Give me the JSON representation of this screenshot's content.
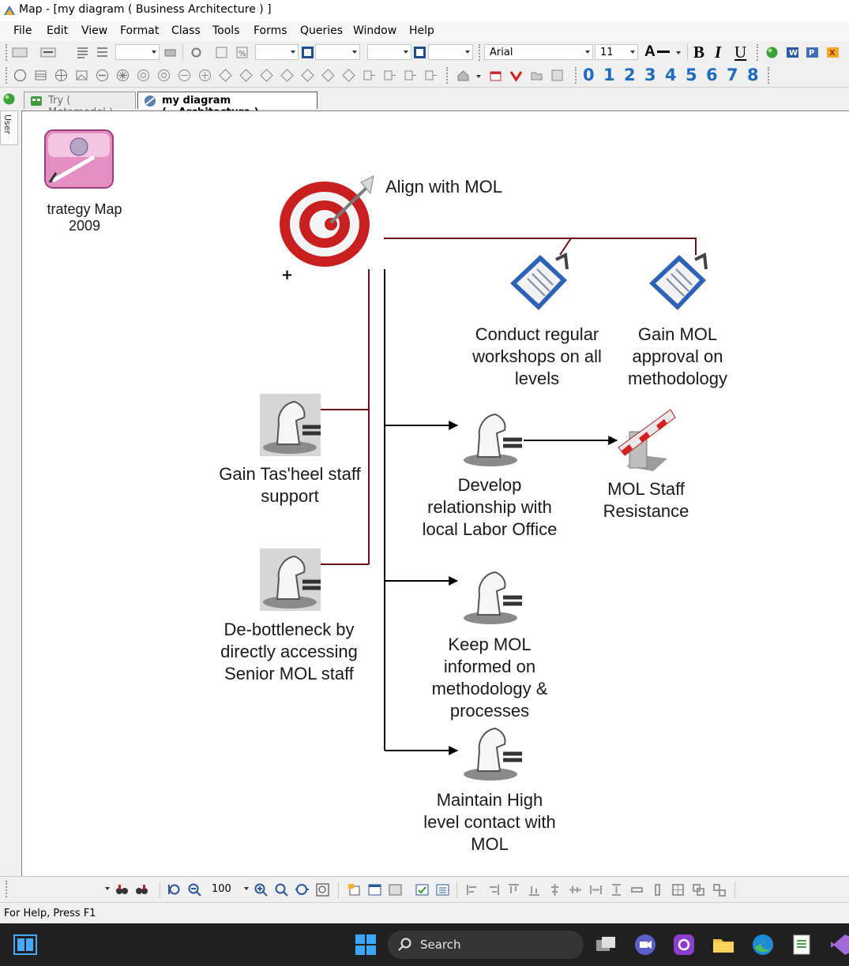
{
  "window": {
    "title": "Map - [my diagram ( Business Architecture ) ]"
  },
  "menu": [
    "File",
    "Edit",
    "View",
    "Format",
    "Class",
    "Tools",
    "Forms",
    "Queries",
    "Window",
    "Help"
  ],
  "format_toolbar": {
    "font": "Arial",
    "font_size": "11",
    "font_color_label": "A",
    "bold": "B",
    "italic": "I",
    "underline": "U"
  },
  "number_toolbar": [
    "0",
    "1",
    "2",
    "3",
    "4",
    "5",
    "6",
    "7",
    "8"
  ],
  "tabs": [
    {
      "label": "Try ( Metamodel )",
      "active": false
    },
    {
      "label": "my diagram (...Architecture )",
      "active": true
    }
  ],
  "side_panel": {
    "tab_label": "User"
  },
  "diagram": {
    "nodes": {
      "strategy_map": "trategy Map\n2009",
      "align": "Align with MOL",
      "conduct": "Conduct regular\nworkshops on all\nlevels",
      "approval": "Gain MOL\napproval on\nmethodology",
      "gain_staff": "Gain Tas'heel staff\nsupport",
      "debottleneck": "De-bottleneck by\ndirectly accessing\nSenior MOL staff",
      "develop": "Develop\nrelationship with\nlocal Labor Office",
      "resistance": "MOL Staff\nResistance",
      "keep_informed": "Keep MOL\ninformed on\nmethodology &\nprocesses",
      "maintain": "Maintain High\nlevel contact with\nMOL"
    },
    "colors": {
      "connector": "#6b1010",
      "arrow": "#000000"
    }
  },
  "zoom": {
    "value": "100"
  },
  "status": {
    "text": "For Help, Press F1"
  },
  "taskbar": {
    "search_label": "Search"
  }
}
